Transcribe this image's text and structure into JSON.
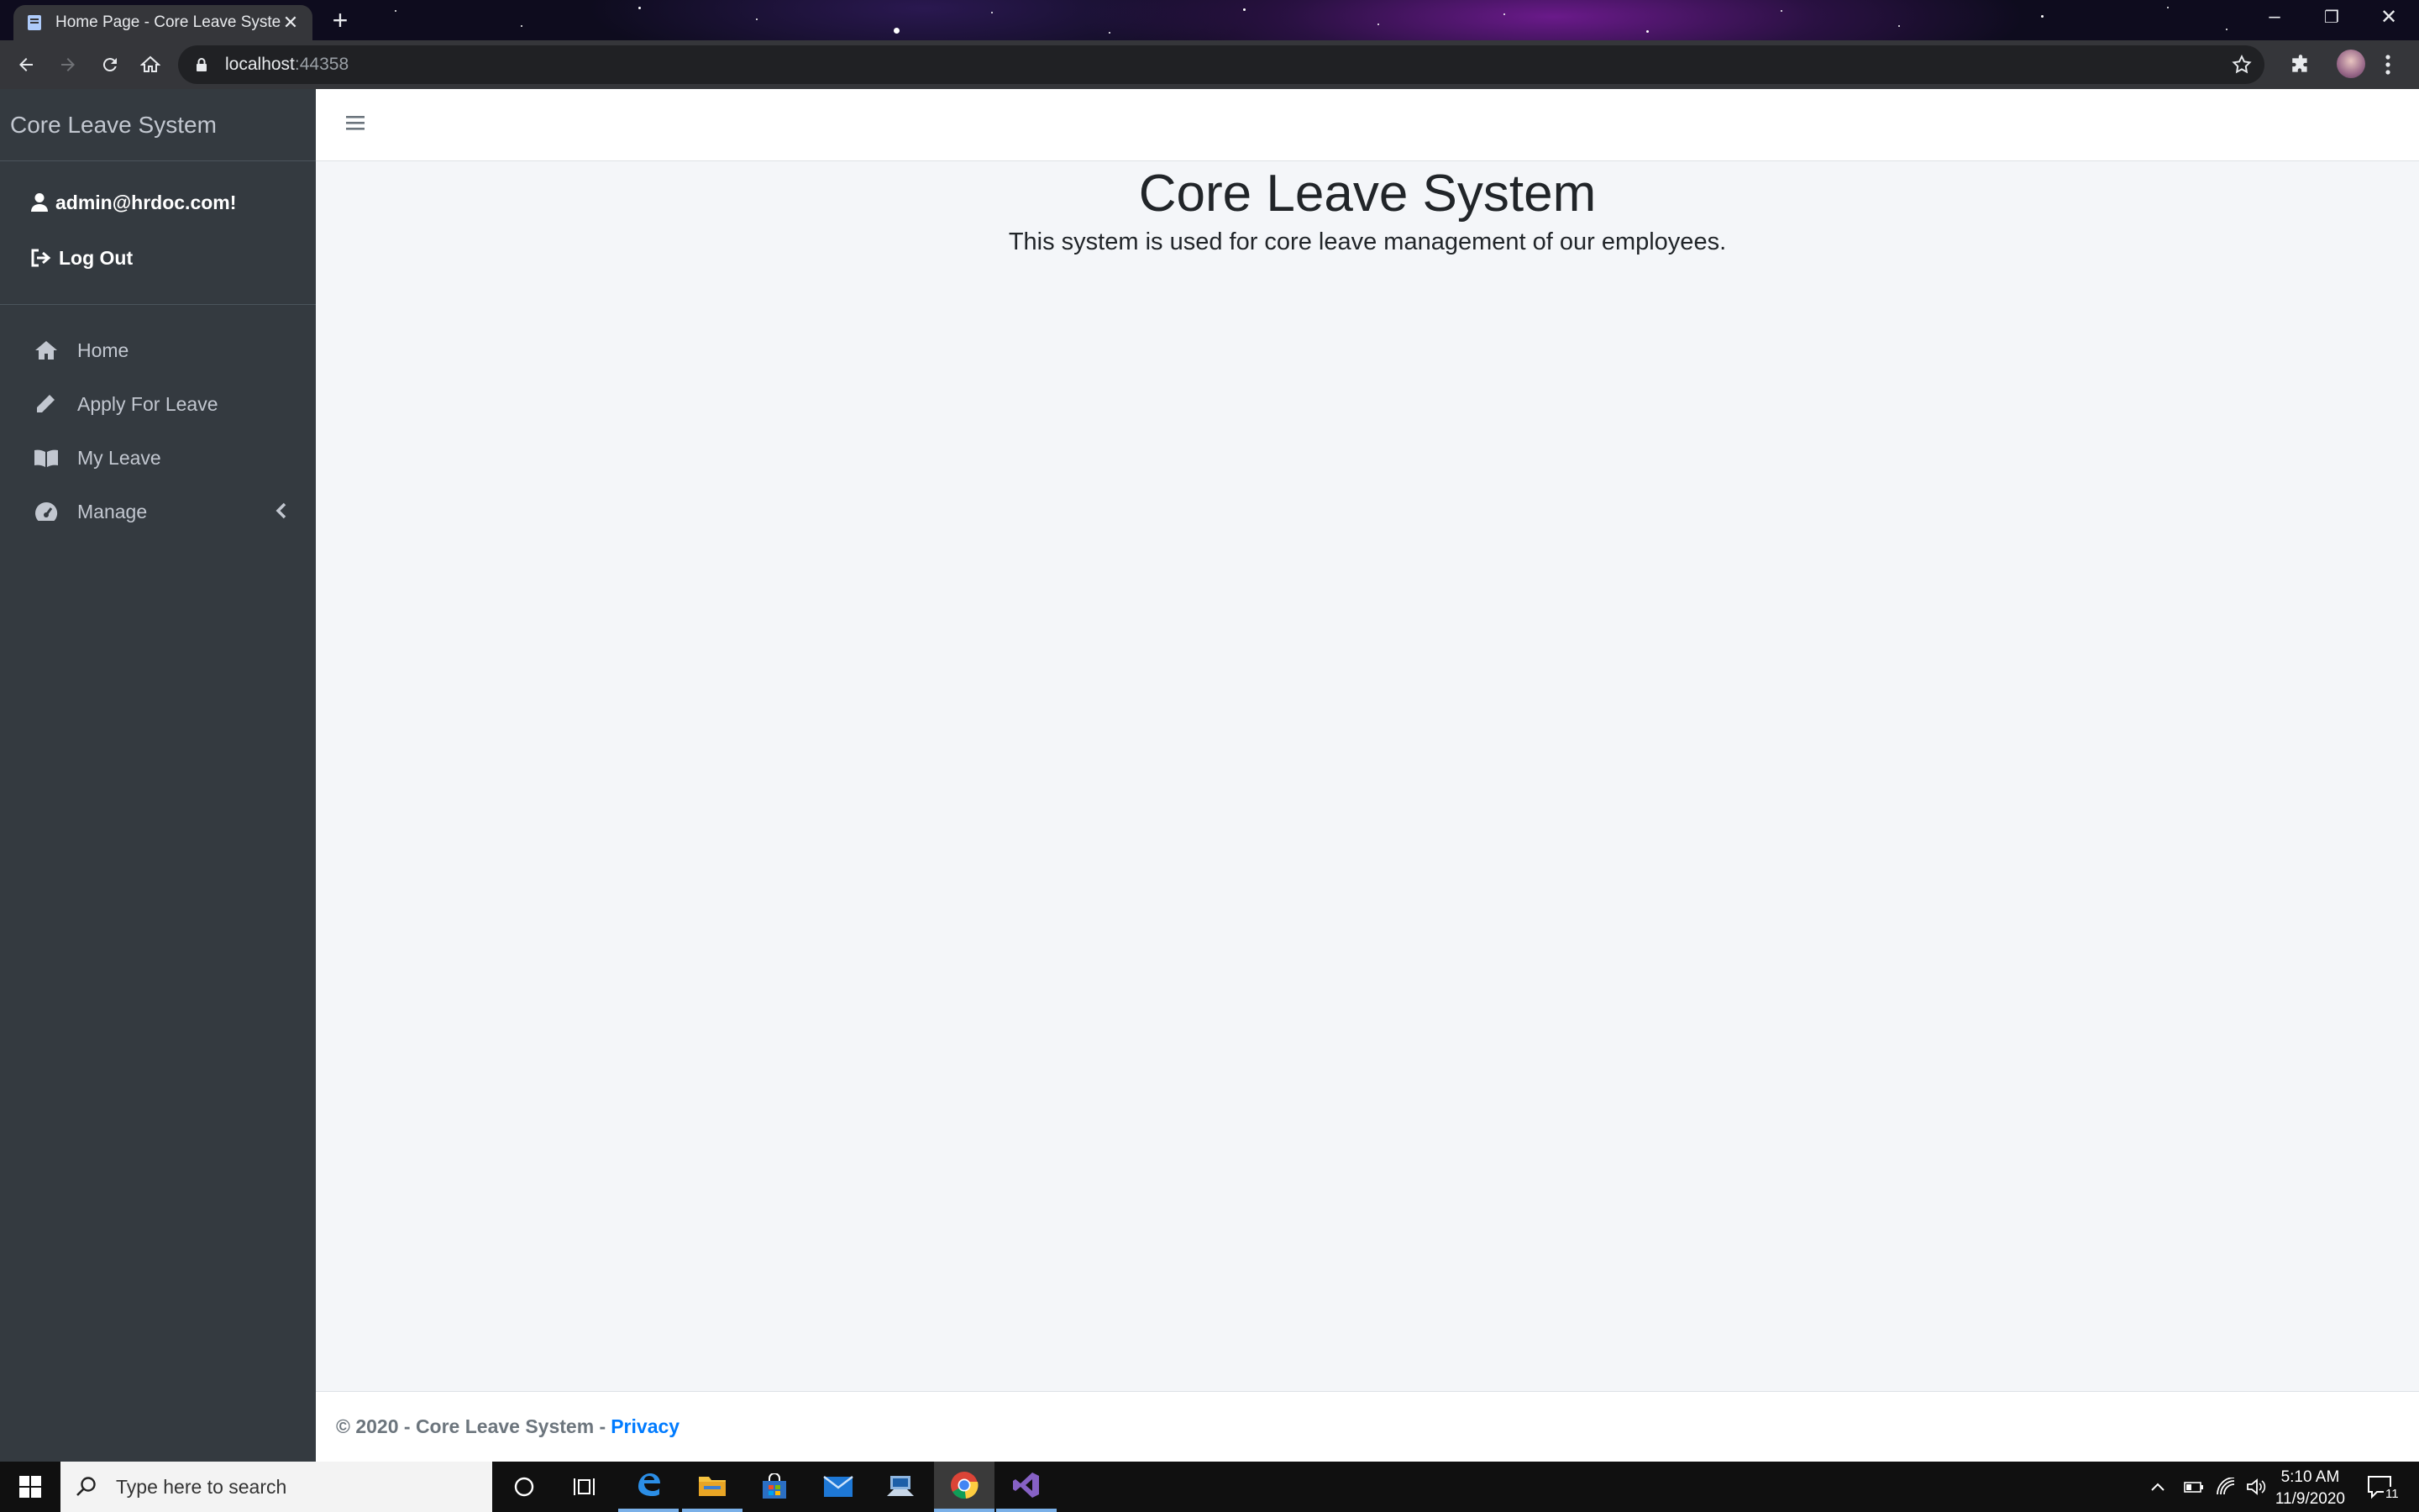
{
  "browser": {
    "tab_title": "Home Page - Core Leave System",
    "url_host": "localhost",
    "url_port": ":44358"
  },
  "sidebar": {
    "brand": "Core Leave System",
    "user_email": "admin@hrdoc.com!",
    "logout_label": "Log Out",
    "items": [
      {
        "label": "Home",
        "icon": "home-icon"
      },
      {
        "label": "Apply For Leave",
        "icon": "pencil-icon"
      },
      {
        "label": "My Leave",
        "icon": "book-icon"
      },
      {
        "label": "Manage",
        "icon": "dashboard-icon"
      }
    ]
  },
  "main": {
    "title": "Core Leave System",
    "lead": "This system is used for core leave management of our employees."
  },
  "footer": {
    "copyright": "© 2020 - Core Leave System -",
    "privacy_label": "Privacy"
  },
  "taskbar": {
    "search_placeholder": "Type here to search",
    "time": "5:10 AM",
    "date": "11/9/2020",
    "notification_count": "11"
  },
  "colors": {
    "sidebar_bg": "#343a40",
    "content_bg": "#f4f6f9",
    "link": "#007bff"
  }
}
